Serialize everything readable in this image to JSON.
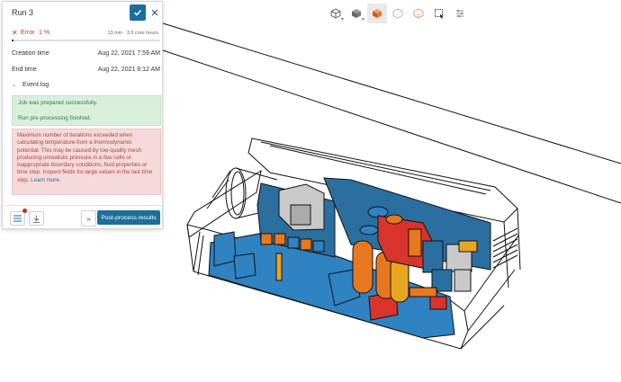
{
  "panel": {
    "title": "Run 3",
    "status": {
      "icon": "error-x-icon",
      "label": "Error",
      "percent": "1 %",
      "progress": 0.01,
      "duration": "13 min · 3.5 core hours"
    },
    "creation_time": {
      "label": "Creation time",
      "value": "Aug 22, 2021 7:59 AM"
    },
    "end_time": {
      "label": "End time",
      "value": "Aug 22, 2021 8:12 AM"
    },
    "event_log": {
      "label": "Event log",
      "success_lines": [
        "Job was prepared successfully.",
        "Run pre-processing finished."
      ],
      "error_message": "Maximum number of iterations exceeded when calculating temperature from a thermodynamic potential. This may be caused by low-quality mesh producing unrealistic pressure in a few cells or inappropriate boundary conditions, fluid properties or time step. Inspect fields for large values in the last time step.",
      "error_link": "Learn more."
    },
    "footer": {
      "postprocess_label": "Post-process results",
      "expand_label": "»"
    }
  },
  "toolbar": {
    "icons": [
      "cube-wireframe-icon",
      "cube-shaded-icon",
      "cube-orange-icon",
      "cube-dotted-icon",
      "cube-outline-icon",
      "box-select-icon",
      "sliders-icon"
    ],
    "active_index": 2
  },
  "colors": {
    "accent": "#1b6f9d",
    "error": "#c9302c",
    "success_bg": "#d8efdd",
    "error_bg": "#f6d9da",
    "part_blue": "#2f83c2",
    "part_orange": "#e8781e",
    "part_red": "#d9342b"
  }
}
